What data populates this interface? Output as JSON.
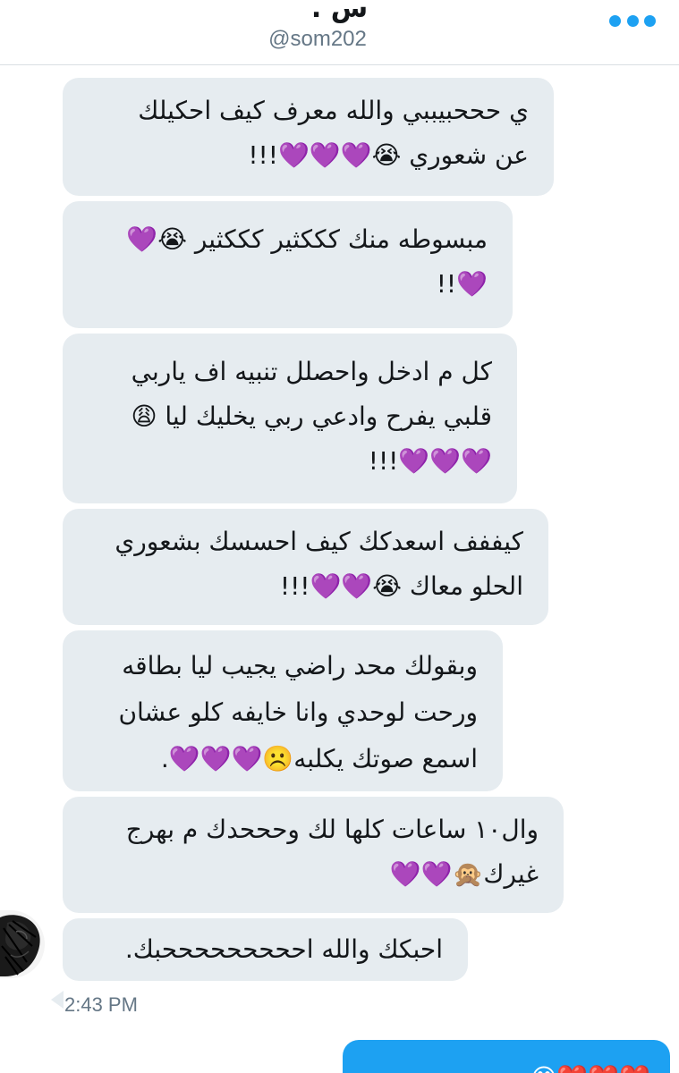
{
  "header": {
    "contact_name": "س .",
    "contact_handle": "@som202",
    "more_icon": "more-horizontal-icon"
  },
  "messages": [
    {
      "lines": [
        "ي حححبيببي والله معرف كيف احكيلك",
        "عن شعوري 😭💜💜💜!!!"
      ]
    },
    {
      "lines": [
        "مبسوطه منك كككثير كككثير 😭💜",
        "💜!!"
      ]
    },
    {
      "lines": [
        "كل م ادخل واحصلل تنبيه اف ياربي",
        "قلبي يفرح وادعي ربي يخليك ليا 😩",
        "💜💜💜!!!"
      ]
    },
    {
      "lines": [
        "كيففف اسعدكك كيف احسسك بشعوري",
        "الحلو معاك 😭💜💜!!!"
      ]
    },
    {
      "lines": [
        "وبقولك محد راضي يجيب ليا بطاقه",
        "ورحت لوحدي وانا خايفه كلو عشان",
        "اسمع صوتك يكلبه☹️💜💜💜."
      ]
    },
    {
      "lines": [
        "وال١٠ ساعات كلها لك وحححدك م بهرج",
        "غيرك🙊💜💜"
      ]
    },
    {
      "lines": [
        "احبكك والله احححححححححبك."
      ]
    }
  ],
  "avatar_icon": "user-avatar-photo",
  "timestamp": "2:43 PM",
  "sent_preview": "❤️❤️❤️😊"
}
